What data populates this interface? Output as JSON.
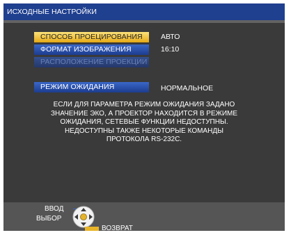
{
  "title": "ИСХОДНЫЕ НАСТРОЙКИ",
  "menu": {
    "projection_method": {
      "label": "СПОСОБ ПРОЕЦИРОВАНИЯ",
      "value": "АВТО"
    },
    "screen_format": {
      "label": "ФОРМАТ ИЗОБРАЖЕНИЯ",
      "value": "16:10"
    },
    "projection_position": {
      "label": "РАСПОЛОЖЕНИЕ ПРОЕКЦИИ"
    },
    "standby_mode": {
      "label": "РЕЖИМ ОЖИДАНИЯ",
      "value": "НОРМАЛЬНОЕ"
    }
  },
  "info_lines": [
    "ЕСЛИ ДЛЯ ПАРАМЕТРА РЕЖИМ ОЖИДАНИЯ ЗАДАНО",
    "ЗНАЧЕНИЕ ЭКО, А ПРОЕКТОР НАХОДИТСЯ В РЕЖИМЕ",
    "ОЖИДАНИЯ, СЕТЕВЫЕ ФУНКЦИИ НЕДОСТУПНЫ.",
    "НЕДОСТУПНЫ ТАКЖЕ НЕКОТОРЫЕ КОМАНДЫ",
    "ПРОТОКОЛА RS-232C."
  ],
  "hints": {
    "enter": "ВВОД",
    "select": "ВЫБОР",
    "return": "ВОЗВРАТ"
  },
  "icons": {
    "dpad": "dpad-icon"
  },
  "colors": {
    "title_bar": "#1f3f8f",
    "selected_item": "#f5c93c",
    "menu_item": "#2b52b3",
    "background": "#3a3a3a"
  }
}
